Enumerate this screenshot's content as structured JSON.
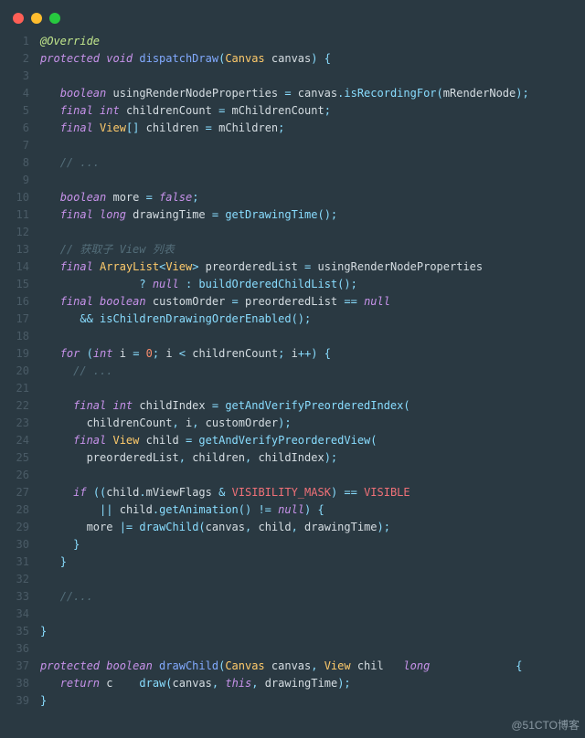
{
  "window": {
    "type": "code-editor",
    "traffic_lights": [
      "close",
      "minimize",
      "zoom"
    ]
  },
  "gutter_start": 1,
  "gutter_end": 39,
  "watermark": "@51CTO博客",
  "code": {
    "l1": [
      [
        "an",
        "@Override"
      ]
    ],
    "l2": [
      [
        "k",
        "protected "
      ],
      [
        "k",
        "void "
      ],
      [
        "fn",
        "dispatchDraw"
      ],
      [
        "op",
        "("
      ],
      [
        "ty",
        "Canvas"
      ],
      [
        "id",
        " canvas"
      ],
      [
        "op",
        ") {"
      ]
    ],
    "l3": [
      [
        "",
        ""
      ]
    ],
    "l4": [
      [
        "",
        "   "
      ],
      [
        "k",
        "boolean "
      ],
      [
        "id",
        "usingRenderNodeProperties "
      ],
      [
        "op",
        "= "
      ],
      [
        "id",
        "canvas"
      ],
      [
        "op",
        "."
      ],
      [
        "fn2",
        "isRecordingFor"
      ],
      [
        "op",
        "("
      ],
      [
        "id",
        "mRenderNode"
      ],
      [
        "op",
        ");"
      ]
    ],
    "l5": [
      [
        "",
        "   "
      ],
      [
        "k",
        "final int "
      ],
      [
        "id",
        "childrenCount "
      ],
      [
        "op",
        "= "
      ],
      [
        "id",
        "mChildrenCount"
      ],
      [
        "op",
        ";"
      ]
    ],
    "l6": [
      [
        "",
        "   "
      ],
      [
        "k",
        "final "
      ],
      [
        "ty",
        "View"
      ],
      [
        "op",
        "[] "
      ],
      [
        "id",
        "children "
      ],
      [
        "op",
        "= "
      ],
      [
        "id",
        "mChildren"
      ],
      [
        "op",
        ";"
      ]
    ],
    "l7": [
      [
        "",
        ""
      ]
    ],
    "l8": [
      [
        "",
        "   "
      ],
      [
        "cm",
        "// ..."
      ]
    ],
    "l9": [
      [
        "",
        ""
      ]
    ],
    "l10": [
      [
        "",
        "   "
      ],
      [
        "k",
        "boolean "
      ],
      [
        "id",
        "more "
      ],
      [
        "op",
        "= "
      ],
      [
        "k",
        "false"
      ],
      [
        "op",
        ";"
      ]
    ],
    "l11": [
      [
        "",
        "   "
      ],
      [
        "k",
        "final long "
      ],
      [
        "id",
        "drawingTime "
      ],
      [
        "op",
        "= "
      ],
      [
        "fn2",
        "getDrawingTime"
      ],
      [
        "op",
        "();"
      ]
    ],
    "l12": [
      [
        "",
        ""
      ]
    ],
    "l13": [
      [
        "",
        "   "
      ],
      [
        "cm",
        "// 获取子 View 列表"
      ]
    ],
    "l14": [
      [
        "",
        "   "
      ],
      [
        "k",
        "final "
      ],
      [
        "ty",
        "ArrayList"
      ],
      [
        "gt",
        "<"
      ],
      [
        "ty",
        "View"
      ],
      [
        "gt",
        ">"
      ],
      [
        "id",
        " preorderedList "
      ],
      [
        "op",
        "= "
      ],
      [
        "id",
        "usingRenderNodeProperties"
      ]
    ],
    "l15": [
      [
        "",
        "               "
      ],
      [
        "op",
        "? "
      ],
      [
        "k",
        "null"
      ],
      [
        "op",
        " : "
      ],
      [
        "fn2",
        "buildOrderedChildList"
      ],
      [
        "op",
        "();"
      ]
    ],
    "l16": [
      [
        "",
        "   "
      ],
      [
        "k",
        "final boolean "
      ],
      [
        "id",
        "customOrder "
      ],
      [
        "op",
        "= "
      ],
      [
        "id",
        "preorderedList "
      ],
      [
        "op",
        "== "
      ],
      [
        "k",
        "null"
      ]
    ],
    "l17": [
      [
        "",
        "      "
      ],
      [
        "op",
        "&& "
      ],
      [
        "fn2",
        "isChildrenDrawingOrderEnabled"
      ],
      [
        "op",
        "();"
      ]
    ],
    "l18": [
      [
        "",
        ""
      ]
    ],
    "l19": [
      [
        "",
        "   "
      ],
      [
        "k",
        "for "
      ],
      [
        "op",
        "("
      ],
      [
        "k",
        "int "
      ],
      [
        "id",
        "i "
      ],
      [
        "op",
        "= "
      ],
      [
        "nm",
        "0"
      ],
      [
        "op",
        "; "
      ],
      [
        "id",
        "i "
      ],
      [
        "op",
        "< "
      ],
      [
        "id",
        "childrenCount"
      ],
      [
        "op",
        "; "
      ],
      [
        "id",
        "i"
      ],
      [
        "op",
        "++) {"
      ]
    ],
    "l20": [
      [
        "",
        "     "
      ],
      [
        "cm",
        "// ..."
      ]
    ],
    "l21": [
      [
        "",
        ""
      ]
    ],
    "l22": [
      [
        "",
        "     "
      ],
      [
        "k",
        "final int "
      ],
      [
        "id",
        "childIndex "
      ],
      [
        "op",
        "= "
      ],
      [
        "fn2",
        "getAndVerifyPreorderedIndex"
      ],
      [
        "op",
        "("
      ]
    ],
    "l23": [
      [
        "",
        "       "
      ],
      [
        "id",
        "childrenCount"
      ],
      [
        "op",
        ", "
      ],
      [
        "id",
        "i"
      ],
      [
        "op",
        ", "
      ],
      [
        "id",
        "customOrder"
      ],
      [
        "op",
        ");"
      ]
    ],
    "l24": [
      [
        "",
        "     "
      ],
      [
        "k",
        "final "
      ],
      [
        "ty",
        "View "
      ],
      [
        "id",
        "child "
      ],
      [
        "op",
        "= "
      ],
      [
        "fn2",
        "getAndVerifyPreorderedView"
      ],
      [
        "op",
        "("
      ]
    ],
    "l25": [
      [
        "",
        "       "
      ],
      [
        "id",
        "preorderedList"
      ],
      [
        "op",
        ", "
      ],
      [
        "id",
        "children"
      ],
      [
        "op",
        ", "
      ],
      [
        "id",
        "childIndex"
      ],
      [
        "op",
        ");"
      ]
    ],
    "l26": [
      [
        "",
        ""
      ]
    ],
    "l27": [
      [
        "",
        "     "
      ],
      [
        "k",
        "if "
      ],
      [
        "op",
        "(("
      ],
      [
        "id",
        "child"
      ],
      [
        "op",
        "."
      ],
      [
        "id",
        "mViewFlags "
      ],
      [
        "op",
        "& "
      ],
      [
        "cn",
        "VISIBILITY_MASK"
      ],
      [
        "op",
        ") == "
      ],
      [
        "cn",
        "VISIBLE"
      ]
    ],
    "l28": [
      [
        "",
        "         "
      ],
      [
        "op",
        "|| "
      ],
      [
        "id",
        "child"
      ],
      [
        "op",
        "."
      ],
      [
        "fn2",
        "getAnimation"
      ],
      [
        "op",
        "() != "
      ],
      [
        "k",
        "null"
      ],
      [
        "op",
        ") {"
      ]
    ],
    "l29": [
      [
        "",
        "       "
      ],
      [
        "id",
        "more "
      ],
      [
        "op",
        "|= "
      ],
      [
        "fn2",
        "drawChild"
      ],
      [
        "op",
        "("
      ],
      [
        "id",
        "canvas"
      ],
      [
        "op",
        ", "
      ],
      [
        "id",
        "child"
      ],
      [
        "op",
        ", "
      ],
      [
        "id",
        "drawingTime"
      ],
      [
        "op",
        ");"
      ]
    ],
    "l30": [
      [
        "",
        "     "
      ],
      [
        "op",
        "}"
      ]
    ],
    "l31": [
      [
        "",
        "   "
      ],
      [
        "op",
        "}"
      ]
    ],
    "l32": [
      [
        "",
        ""
      ]
    ],
    "l33": [
      [
        "",
        "   "
      ],
      [
        "cm",
        "//..."
      ]
    ],
    "l34": [
      [
        "",
        ""
      ]
    ],
    "l35": [
      [
        "op",
        "}"
      ]
    ],
    "l36": [
      [
        "",
        ""
      ]
    ],
    "l37": [
      [
        "k",
        "protected boolean "
      ],
      [
        "fn",
        "drawChild"
      ],
      [
        "op",
        "("
      ],
      [
        "ty",
        "Canvas "
      ],
      [
        "id",
        "canvas"
      ],
      [
        "op",
        ", "
      ],
      [
        "ty",
        "View "
      ],
      [
        "id",
        "chil   "
      ],
      [
        "k",
        "long"
      ],
      [
        "id",
        "             "
      ],
      [
        "op",
        "{"
      ]
    ],
    "l38": [
      [
        "",
        "   "
      ],
      [
        "k",
        "return "
      ],
      [
        "id",
        "c    "
      ],
      [
        "fn2",
        "draw"
      ],
      [
        "op",
        "("
      ],
      [
        "id",
        "canvas"
      ],
      [
        "op",
        ", "
      ],
      [
        "k",
        "this"
      ],
      [
        "op",
        ", "
      ],
      [
        "id",
        "drawingTime"
      ],
      [
        "op",
        ");"
      ]
    ],
    "l39": [
      [
        "op",
        "}"
      ]
    ]
  }
}
